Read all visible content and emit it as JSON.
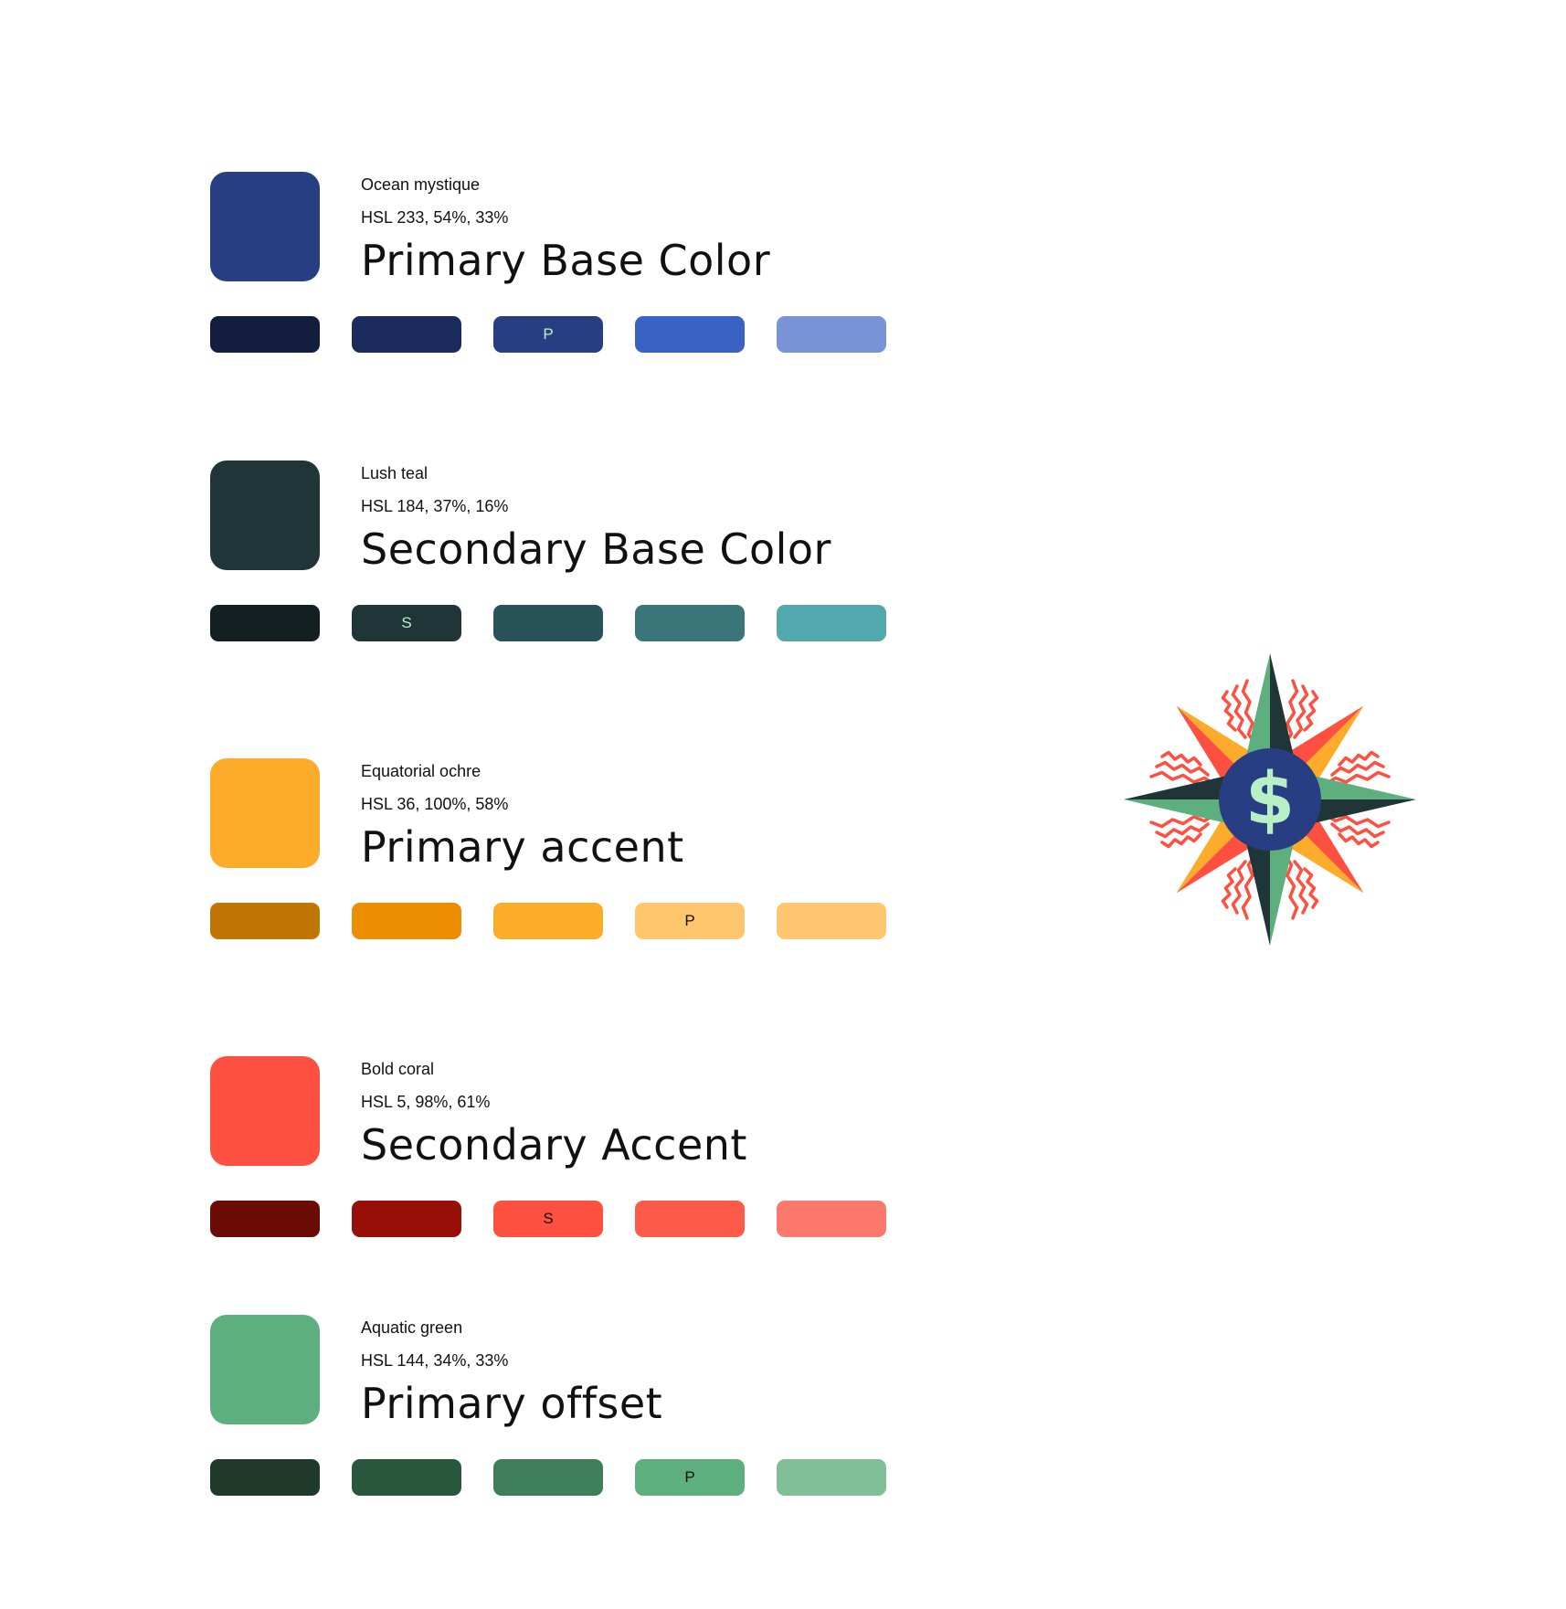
{
  "palettes": [
    {
      "name": "Ocean mystique",
      "hsl": "HSL 233, 54%, 33%",
      "title": "Primary Base Color",
      "main_color": "#273F82",
      "shades": [
        {
          "color": "#131D3D",
          "label": "",
          "text_color": "#FFFFFF"
        },
        {
          "color": "#1B2B5E",
          "label": "",
          "text_color": "#FFFFFF"
        },
        {
          "color": "#273F82",
          "label": "P",
          "text_color": "#B8F0C6"
        },
        {
          "color": "#3A62C5",
          "label": "",
          "text_color": "#FFFFFF"
        },
        {
          "color": "#7894D6",
          "label": "",
          "text_color": "#FFFFFF"
        }
      ]
    },
    {
      "name": "Lush teal",
      "hsl": "HSL 184, 37%, 16%",
      "title": "Secondary Base Color",
      "main_color": "#1F3538",
      "shades": [
        {
          "color": "#131F20",
          "label": "",
          "text_color": "#FFFFFF"
        },
        {
          "color": "#1F3538",
          "label": "S",
          "text_color": "#B8F0C6"
        },
        {
          "color": "#285358",
          "label": "",
          "text_color": "#FFFFFF"
        },
        {
          "color": "#3A7679",
          "label": "",
          "text_color": "#FFFFFF"
        },
        {
          "color": "#51A8AD",
          "label": "",
          "text_color": "#FFFFFF"
        }
      ]
    },
    {
      "name": "Equatorial ochre",
      "hsl": "HSL 36, 100%, 58%",
      "title": "Primary accent",
      "main_color": "#FDAB2A",
      "shades": [
        {
          "color": "#C07403",
          "label": "",
          "text_color": "#111111"
        },
        {
          "color": "#EC8E00",
          "label": "",
          "text_color": "#111111"
        },
        {
          "color": "#FDAB2A",
          "label": "",
          "text_color": "#111111"
        },
        {
          "color": "#FFC66E",
          "label": "P",
          "text_color": "#111111"
        },
        {
          "color": "#FFC56F",
          "label": "",
          "text_color": "#111111"
        }
      ]
    },
    {
      "name": "Bold coral",
      "hsl": "HSL 5, 98%, 61%",
      "title": "Secondary Accent",
      "main_color": "#FE5040",
      "shades": [
        {
          "color": "#6A0C05",
          "label": "",
          "text_color": "#FFFFFF"
        },
        {
          "color": "#970F06",
          "label": "",
          "text_color": "#FFFFFF"
        },
        {
          "color": "#FE5040",
          "label": "S",
          "text_color": "#111111"
        },
        {
          "color": "#FD5A4A",
          "label": "",
          "text_color": "#111111"
        },
        {
          "color": "#FC776C",
          "label": "",
          "text_color": "#111111"
        }
      ]
    },
    {
      "name": "Aquatic green",
      "hsl": "HSL 144, 34%, 33%",
      "title": "Primary offset",
      "main_color": "#5DAF7E",
      "shades": [
        {
          "color": "#1F3A2A",
          "label": "",
          "text_color": "#FFFFFF"
        },
        {
          "color": "#29573E",
          "label": "",
          "text_color": "#FFFFFF"
        },
        {
          "color": "#3E7F5A",
          "label": "",
          "text_color": "#FFFFFF"
        },
        {
          "color": "#5DAF7E",
          "label": "P",
          "text_color": "#111111"
        },
        {
          "color": "#80BF98",
          "label": "",
          "text_color": "#111111"
        }
      ]
    }
  ],
  "emblem": {
    "symbol": "$",
    "icon": "compass-rose-dollar-icon",
    "colors": {
      "center": "#273F82",
      "symbol": "#B8F0C6",
      "point_dark": "#1F3538",
      "point_light": "#5DAF7E",
      "ray_orange": "#FDAB2A",
      "ray_coral": "#FE5040"
    }
  }
}
